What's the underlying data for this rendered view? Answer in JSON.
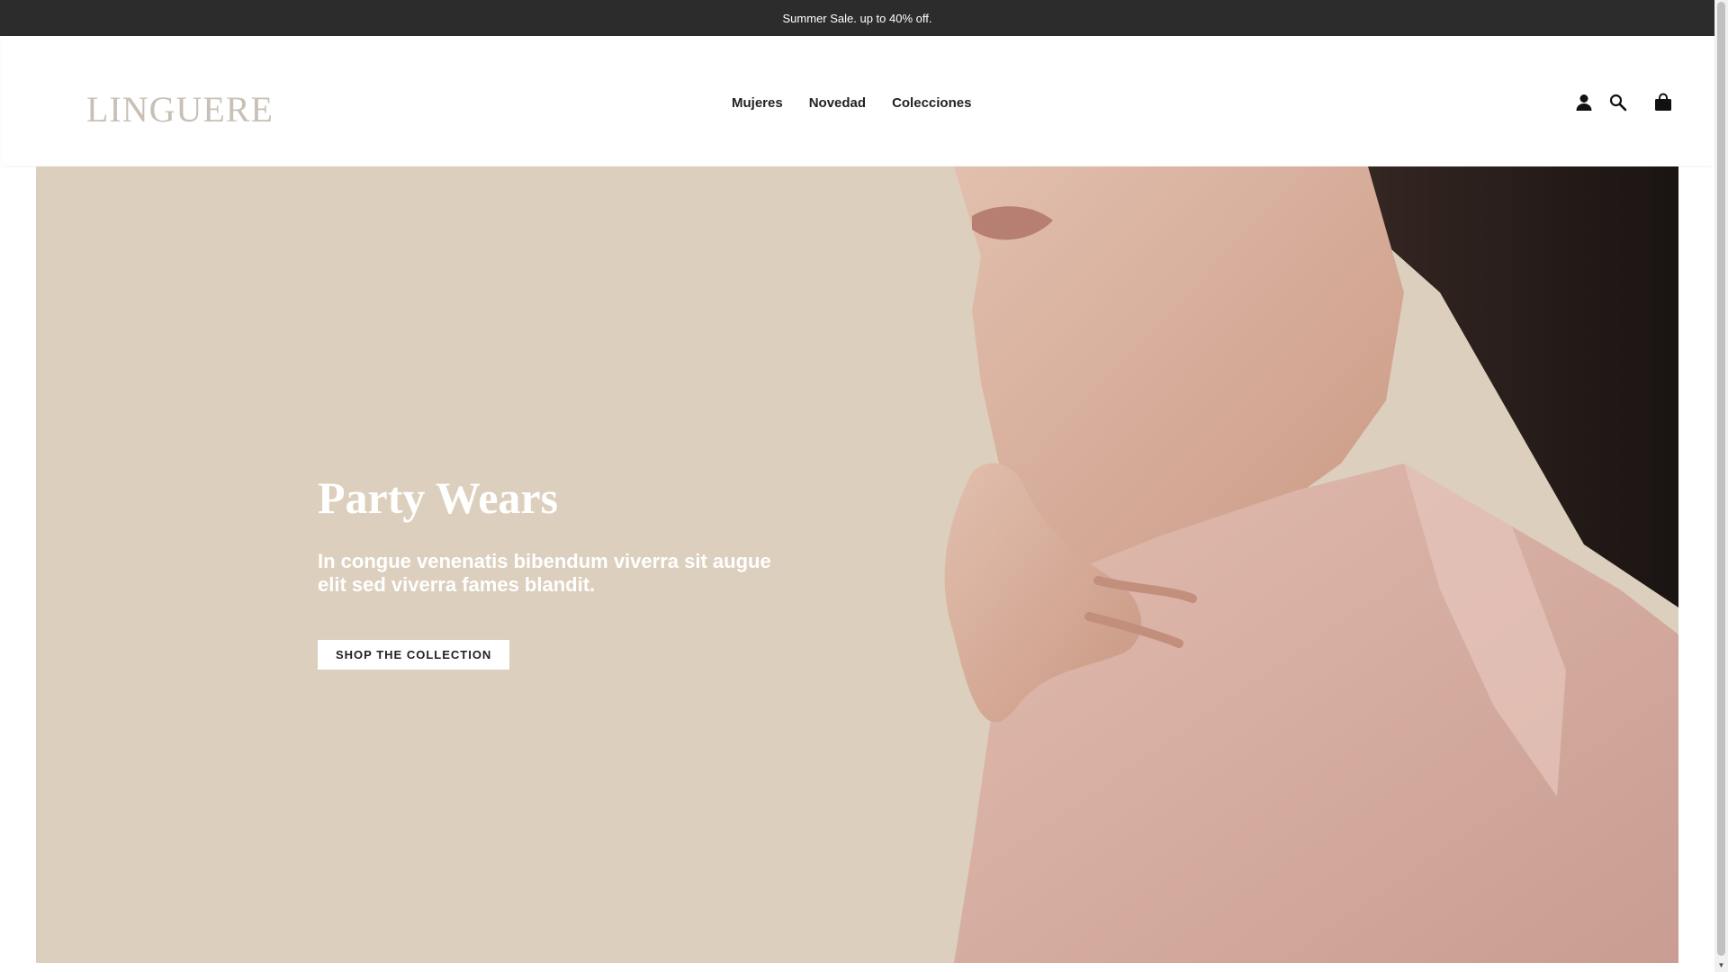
{
  "announcement": {
    "text": "Summer Sale. up to 40% off."
  },
  "header": {
    "logo": "LINGUERE",
    "nav": [
      {
        "label": "Mujeres"
      },
      {
        "label": "Novedad"
      },
      {
        "label": "Colecciones"
      }
    ],
    "icons": [
      "account-icon",
      "search-icon",
      "cart-bag-icon"
    ]
  },
  "hero": {
    "title": "Party Wears",
    "subtitle": "In congue venenatis bibendum viverra sit augue elit sed viverra fames blandit.",
    "button_label": "SHOP THE COLLECTION",
    "background_color": "#dccfbd",
    "blouse_color": "#d9a99b"
  },
  "colors": {
    "announcement_bg": "#2c2c2c",
    "logo": "#c9c0b5",
    "nav_text": "#222222"
  }
}
